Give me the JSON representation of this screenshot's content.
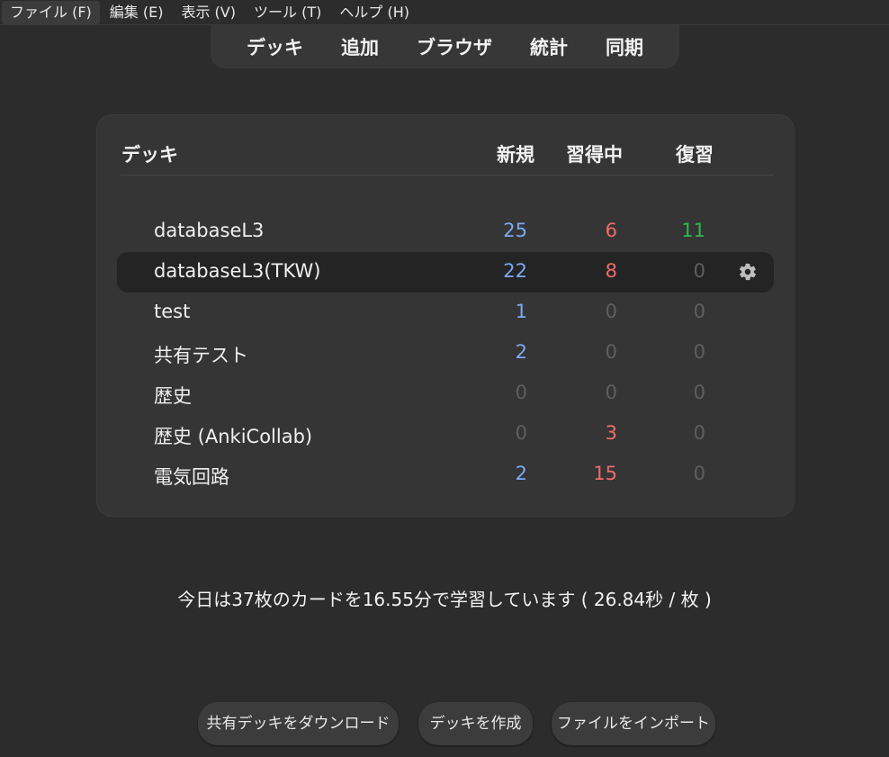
{
  "menubar": {
    "items": [
      "ファイル (F)",
      "編集 (E)",
      "表示 (V)",
      "ツール (T)",
      "ヘルプ (H)"
    ]
  },
  "toolbar": {
    "items": [
      "デッキ",
      "追加",
      "ブラウザ",
      "統計",
      "同期"
    ]
  },
  "deck_table": {
    "headers": {
      "deck": "デッキ",
      "new": "新規",
      "learning": "習得中",
      "review": "復習"
    },
    "rows": [
      {
        "name": "databaseL3",
        "new": "25",
        "learning": "6",
        "review": "11"
      },
      {
        "name": "databaseL3(TKW)",
        "new": "22",
        "learning": "8",
        "review": "0"
      },
      {
        "name": "test",
        "new": "1",
        "learning": "0",
        "review": "0"
      },
      {
        "name": "共有テスト",
        "new": "2",
        "learning": "0",
        "review": "0"
      },
      {
        "name": "歴史",
        "new": "0",
        "learning": "0",
        "review": "0"
      },
      {
        "name": "歴史 (AnkiCollab)",
        "new": "0",
        "learning": "3",
        "review": "0"
      },
      {
        "name": "電気回路",
        "new": "2",
        "learning": "15",
        "review": "0"
      }
    ],
    "current_row": 1,
    "options_icon": "gear-icon"
  },
  "summary": {
    "text": "今日は37枚のカードを16.55分で学習しています ( 26.84秒 / 枚 )"
  },
  "buttons": {
    "shared": "共有デッキをダウンロード",
    "create": "デッキを作成",
    "import": "ファイルをインポート"
  },
  "colors": {
    "background": "#2c2c2c",
    "panel": "#353535",
    "new": "#7aa9f0",
    "learning": "#f06a6a",
    "review": "#2fb84f",
    "zero": "#5f5f5f"
  }
}
